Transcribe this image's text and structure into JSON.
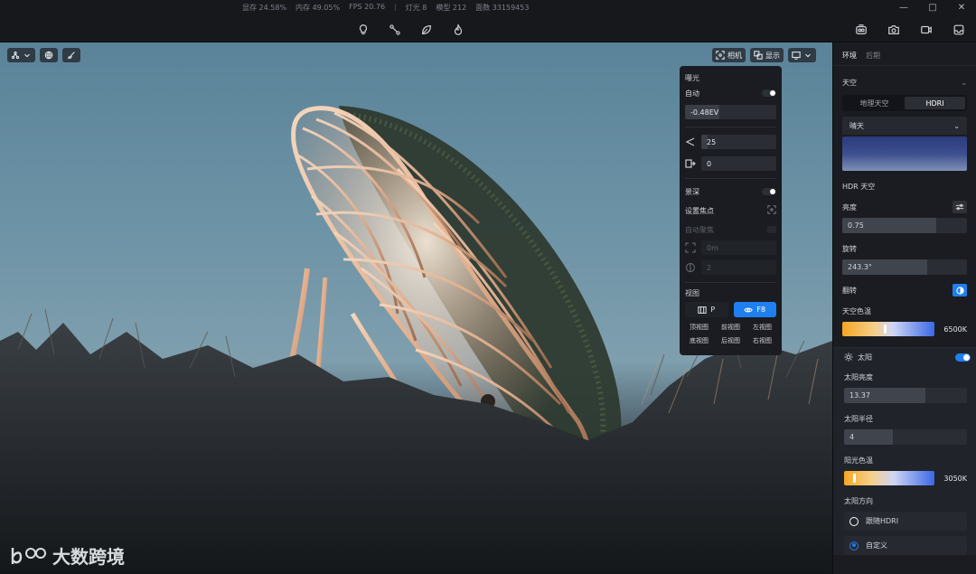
{
  "statusbar": {
    "vram": "显存 24.58%",
    "memory": "内存 49.05%",
    "fps": "FPS 20.76",
    "lights": "灯光 8",
    "models": "模型 212",
    "faces": "面数 33159453"
  },
  "window_controls": {
    "minimize": "—",
    "maximize": "□",
    "close": "✕"
  },
  "toolbar": {
    "center_icons": [
      "lightbulb-icon",
      "path-icon",
      "leaf-icon",
      "fire-icon"
    ],
    "right_icons": [
      "render-icon",
      "camera-icon",
      "video-icon",
      "inbox-icon"
    ]
  },
  "viewport": {
    "camera_button": "相机",
    "display_button": "显示",
    "watermark": "大数跨境"
  },
  "camera_panel": {
    "exposure_title": "曝光",
    "auto_label": "自动",
    "ev_value": "-0.48EV",
    "ev_fill": 0.38,
    "fov_value": "25",
    "offset_value": "0",
    "dof_title": "景深",
    "set_focus_label": "设置焦点",
    "auto_focus_label": "自动聚焦",
    "focus_distance": "0m",
    "aperture_value": "2",
    "view_title": "视图",
    "perspective_button": "P",
    "f8_button": "F8",
    "views": [
      "顶视图",
      "前视图",
      "左视图",
      "底视图",
      "后视图",
      "右视图"
    ]
  },
  "right_panel": {
    "tabs": [
      "环境",
      "后期"
    ],
    "sky_title": "天空",
    "sky_modes": [
      "地理天空",
      "HDRI"
    ],
    "sky_preset": "晴天",
    "hdr_sky_label": "HDR 天空",
    "brightness_label": "亮度",
    "brightness_value": "0.75",
    "brightness_fill": 0.75,
    "rotation_label": "旋转",
    "rotation_value": "243.3°",
    "rotation_fill": 0.68,
    "flip_label": "翻转",
    "sky_temp_label": "天空色温",
    "sky_temp_value": "6500K",
    "sun_label": "太阳",
    "sun_brightness_label": "太阳亮度",
    "sun_brightness_value": "13.37",
    "sun_brightness_fill": 0.66,
    "sun_radius_label": "太阳半径",
    "sun_radius_value": "4",
    "sun_radius_fill": 0.4,
    "sunlight_temp_label": "阳光色温",
    "sunlight_temp_value": "3050K",
    "sun_direction_label": "太阳方向",
    "follow_hdri_label": "跟随HDRI",
    "custom_label": "自定义"
  },
  "colors": {
    "accent": "#1f7ff0",
    "panel_bg": "#1a1c21"
  }
}
